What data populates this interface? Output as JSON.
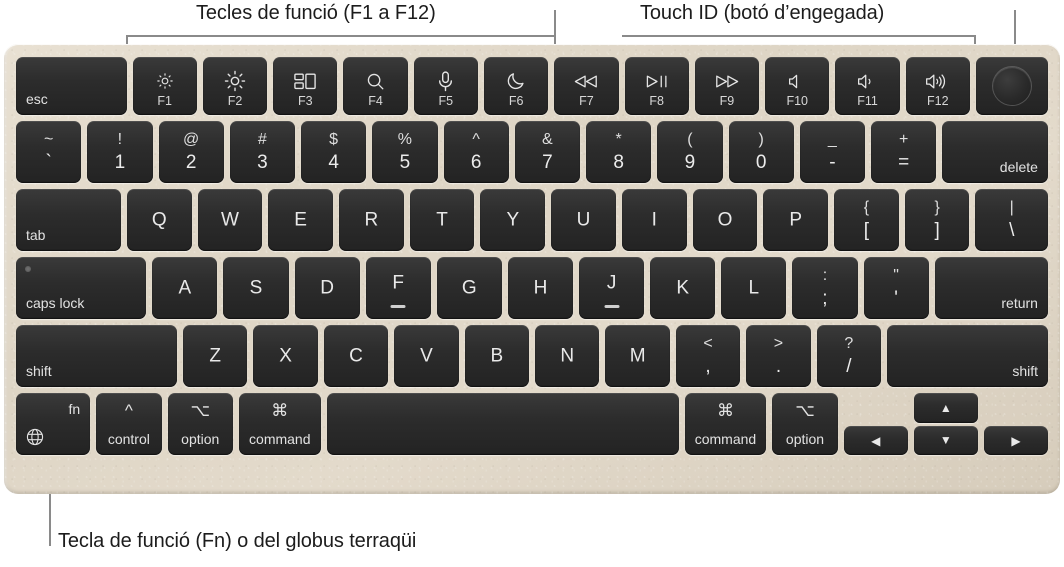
{
  "callouts": {
    "function_keys": "Tecles de funció (F1 a F12)",
    "touch_id": "Touch ID (botó d’engegada)",
    "fn_key": "Tecla de funció (Fn) o del globus terraqüi"
  },
  "colors": {
    "chassis": "#e0d7c7",
    "key": "#2c2c2c",
    "key_text": "#e9e9e9",
    "leader_line": "#8a8a8a",
    "caption_text": "#1c1c1c"
  },
  "keyboard": {
    "rows": {
      "function_row": [
        {
          "name": "esc",
          "center": "",
          "caption": "",
          "corner": "esc",
          "icon": ""
        },
        {
          "name": "f1",
          "center": "",
          "caption": "F1",
          "corner": "",
          "icon": "brightness-down-icon"
        },
        {
          "name": "f2",
          "center": "",
          "caption": "F2",
          "corner": "",
          "icon": "brightness-up-icon"
        },
        {
          "name": "f3",
          "center": "",
          "caption": "F3",
          "corner": "",
          "icon": "mission-control-icon"
        },
        {
          "name": "f4",
          "center": "",
          "caption": "F4",
          "corner": "",
          "icon": "spotlight-search-icon"
        },
        {
          "name": "f5",
          "center": "",
          "caption": "F5",
          "corner": "",
          "icon": "dictation-microphone-icon"
        },
        {
          "name": "f6",
          "center": "",
          "caption": "F6",
          "corner": "",
          "icon": "do-not-disturb-moon-icon"
        },
        {
          "name": "f7",
          "center": "",
          "caption": "F7",
          "corner": "",
          "icon": "rewind-icon"
        },
        {
          "name": "f8",
          "center": "",
          "caption": "F8",
          "corner": "",
          "icon": "play-pause-icon"
        },
        {
          "name": "f9",
          "center": "",
          "caption": "F9",
          "corner": "",
          "icon": "fast-forward-icon"
        },
        {
          "name": "f10",
          "center": "",
          "caption": "F10",
          "corner": "",
          "icon": "volume-mute-icon"
        },
        {
          "name": "f11",
          "center": "",
          "caption": "F11",
          "corner": "",
          "icon": "volume-down-icon"
        },
        {
          "name": "f12",
          "center": "",
          "caption": "F12",
          "corner": "",
          "icon": "volume-up-icon"
        },
        {
          "name": "touch-id",
          "center": "",
          "caption": "",
          "corner": "",
          "icon": "touch-id-icon"
        }
      ],
      "number_row": [
        {
          "name": "backtick",
          "upper": "~",
          "lower": "`"
        },
        {
          "name": "digit-1",
          "upper": "!",
          "lower": "1"
        },
        {
          "name": "digit-2",
          "upper": "@",
          "lower": "2"
        },
        {
          "name": "digit-3",
          "upper": "#",
          "lower": "3"
        },
        {
          "name": "digit-4",
          "upper": "$",
          "lower": "4"
        },
        {
          "name": "digit-5",
          "upper": "%",
          "lower": "5"
        },
        {
          "name": "digit-6",
          "upper": "^",
          "lower": "6"
        },
        {
          "name": "digit-7",
          "upper": "&",
          "lower": "7"
        },
        {
          "name": "digit-8",
          "upper": "*",
          "lower": "8"
        },
        {
          "name": "digit-9",
          "upper": "(",
          "lower": "9"
        },
        {
          "name": "digit-0",
          "upper": ")",
          "lower": "0"
        },
        {
          "name": "hyphen",
          "upper": "_",
          "lower": "-"
        },
        {
          "name": "equals",
          "upper": "+",
          "lower": "="
        },
        {
          "name": "delete",
          "corner": "delete"
        }
      ],
      "top_letter_row": [
        {
          "name": "tab",
          "corner": "tab"
        },
        {
          "name": "letter-q",
          "center": "Q"
        },
        {
          "name": "letter-w",
          "center": "W"
        },
        {
          "name": "letter-e",
          "center": "E"
        },
        {
          "name": "letter-r",
          "center": "R"
        },
        {
          "name": "letter-t",
          "center": "T"
        },
        {
          "name": "letter-y",
          "center": "Y"
        },
        {
          "name": "letter-u",
          "center": "U"
        },
        {
          "name": "letter-i",
          "center": "I"
        },
        {
          "name": "letter-o",
          "center": "O"
        },
        {
          "name": "letter-p",
          "center": "P"
        },
        {
          "name": "bracket-left",
          "upper": "{",
          "lower": "["
        },
        {
          "name": "bracket-right",
          "upper": "}",
          "lower": "]"
        },
        {
          "name": "backslash",
          "upper": "|",
          "lower": "\\"
        }
      ],
      "home_row": [
        {
          "name": "caps-lock",
          "corner": "caps lock"
        },
        {
          "name": "letter-a",
          "center": "A"
        },
        {
          "name": "letter-s",
          "center": "S"
        },
        {
          "name": "letter-d",
          "center": "D"
        },
        {
          "name": "letter-f",
          "center": "F",
          "homing": true
        },
        {
          "name": "letter-g",
          "center": "G"
        },
        {
          "name": "letter-h",
          "center": "H"
        },
        {
          "name": "letter-j",
          "center": "J",
          "homing": true
        },
        {
          "name": "letter-k",
          "center": "K"
        },
        {
          "name": "letter-l",
          "center": "L"
        },
        {
          "name": "semicolon",
          "upper": ":",
          "lower": ";"
        },
        {
          "name": "quote",
          "upper": "\"",
          "lower": "'"
        },
        {
          "name": "return",
          "corner": "return"
        }
      ],
      "bottom_letter_row": [
        {
          "name": "shift-left",
          "corner": "shift"
        },
        {
          "name": "letter-z",
          "center": "Z"
        },
        {
          "name": "letter-x",
          "center": "X"
        },
        {
          "name": "letter-c",
          "center": "C"
        },
        {
          "name": "letter-v",
          "center": "V"
        },
        {
          "name": "letter-b",
          "center": "B"
        },
        {
          "name": "letter-n",
          "center": "N"
        },
        {
          "name": "letter-m",
          "center": "M"
        },
        {
          "name": "comma",
          "upper": "<",
          "lower": ","
        },
        {
          "name": "period",
          "upper": ">",
          "lower": "."
        },
        {
          "name": "slash",
          "upper": "?",
          "lower": "/"
        },
        {
          "name": "shift-right",
          "corner": "shift"
        }
      ],
      "modifier_row": {
        "fn": {
          "name": "fn",
          "corner": "fn",
          "icon": "globe-icon"
        },
        "control": {
          "name": "control",
          "caption": "control",
          "symbol": "^"
        },
        "option_left": {
          "name": "option-left",
          "caption": "option",
          "symbol": "⌥"
        },
        "command_left": {
          "name": "command-left",
          "caption": "command",
          "symbol": "⌘"
        },
        "space": {
          "name": "space-bar",
          "caption": ""
        },
        "command_right": {
          "name": "command-right",
          "caption": "command",
          "symbol": "⌘"
        },
        "option_right": {
          "name": "option-right",
          "caption": "option",
          "symbol": "⌥"
        },
        "arrow_left": {
          "name": "arrow-left",
          "symbol": "◀"
        },
        "arrow_up": {
          "name": "arrow-up",
          "symbol": "▲"
        },
        "arrow_down": {
          "name": "arrow-down",
          "symbol": "▼"
        },
        "arrow_right": {
          "name": "arrow-right",
          "symbol": "▶"
        }
      }
    }
  }
}
